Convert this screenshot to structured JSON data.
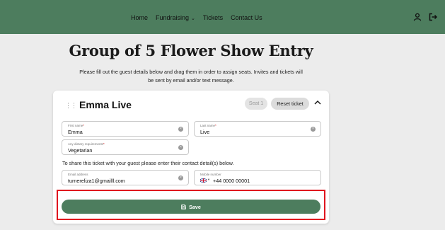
{
  "nav": {
    "home": "Home",
    "fundraising": "Fundraising",
    "tickets": "Tickets",
    "contact": "Contact Us"
  },
  "page": {
    "title": "Group of 5 Flower Show Entry",
    "intro": "Please fill out the guest details below and drag them in order to assign seats. Invites and tickets will be sent by email and/or text message."
  },
  "guest": {
    "name": "Emma Live",
    "seat": "Seat 1",
    "reset_label": "Reset ticket",
    "first_name_label": "First name",
    "first_name": "Emma",
    "last_name_label": "Last name",
    "last_name": "Live",
    "dietary_label": "Any dietary requirements",
    "dietary": "Vegetarian",
    "share_text": "To share this ticket with your guest please enter their contact detail(s) below.",
    "email_label": "Email address",
    "email": "turnereliza1@gmailll.com",
    "mobile_label": "Mobile number",
    "mobile": "+44 0000 00001"
  },
  "actions": {
    "save_label": "Save"
  },
  "colors": {
    "brand_green": "#4d7d5e",
    "highlight_red": "#e0141e"
  },
  "icons": {
    "account": "user-icon",
    "logout": "logout-icon",
    "drag": "drag-handle-icon",
    "collapse": "chevron-up-icon",
    "clear": "clear-icon",
    "save": "save-icon",
    "flag": "uk-flag-icon"
  }
}
